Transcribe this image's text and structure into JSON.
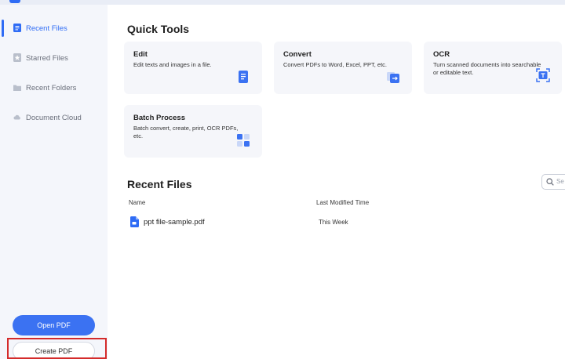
{
  "sidebar": {
    "items": [
      {
        "label": "Recent Files",
        "icon": "recent-files-icon"
      },
      {
        "label": "Starred Files",
        "icon": "star-icon"
      },
      {
        "label": "Recent Folders",
        "icon": "folder-icon"
      },
      {
        "label": "Document Cloud",
        "icon": "cloud-icon"
      }
    ],
    "open_pdf_label": "Open PDF",
    "create_pdf_label": "Create PDF"
  },
  "quick_tools": {
    "title": "Quick Tools",
    "cards": [
      {
        "title": "Edit",
        "description": "Edit texts and images in a file.",
        "icon": "edit-document-icon"
      },
      {
        "title": "Convert",
        "description": "Convert PDFs to Word, Excel, PPT, etc.",
        "icon": "convert-icon"
      },
      {
        "title": "OCR",
        "description": "Turn scanned documents into searchable or editable text.",
        "icon": "ocr-scan-icon"
      },
      {
        "title": "Batch Process",
        "description": "Batch convert, create, print, OCR PDFs, etc.",
        "icon": "batch-grid-icon"
      }
    ]
  },
  "recent_files": {
    "title": "Recent Files",
    "search_placeholder": "Se",
    "columns": [
      "Name",
      "Last Modified Time"
    ],
    "rows": [
      {
        "name": "ppt file-sample.pdf",
        "modified": "This Week",
        "icon": "pdf-file-icon"
      }
    ]
  },
  "colors": {
    "accent": "#2f6cf5",
    "sidebar_bg": "#f4f6fb",
    "card_bg": "#f5f6fa",
    "highlight_border": "#d42b2b"
  }
}
